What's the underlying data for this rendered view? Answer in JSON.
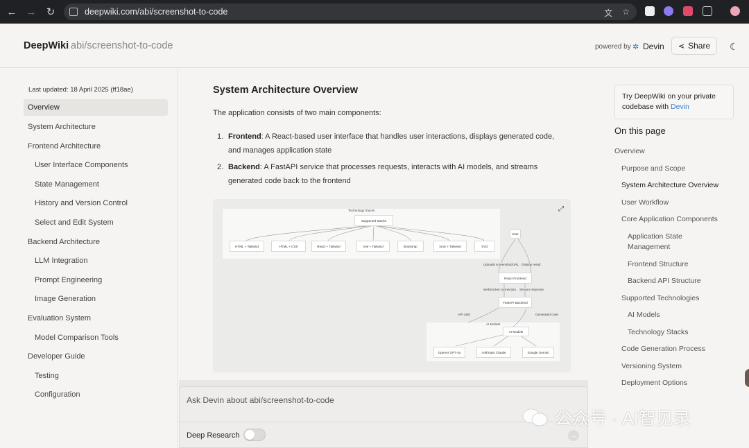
{
  "browser": {
    "url": "deepwiki.com/abi/screenshot-to-code"
  },
  "header": {
    "brand": "DeepWiki",
    "repo": "abi/screenshot-to-code",
    "powered_by": "powered by",
    "devin": "Devin",
    "share": "Share"
  },
  "left_nav": {
    "last_updated": "Last updated: 18 April 2025 (ff18ae)",
    "items": [
      {
        "label": "Overview",
        "level": 1,
        "active": true
      },
      {
        "label": "System Architecture",
        "level": 1
      },
      {
        "label": "Frontend Architecture",
        "level": 1
      },
      {
        "label": "User Interface Components",
        "level": 2
      },
      {
        "label": "State Management",
        "level": 2
      },
      {
        "label": "History and Version Control",
        "level": 2
      },
      {
        "label": "Select and Edit System",
        "level": 2
      },
      {
        "label": "Backend Architecture",
        "level": 1
      },
      {
        "label": "LLM Integration",
        "level": 2
      },
      {
        "label": "Prompt Engineering",
        "level": 2
      },
      {
        "label": "Image Generation",
        "level": 2
      },
      {
        "label": "Evaluation System",
        "level": 1
      },
      {
        "label": "Model Comparison Tools",
        "level": 2
      },
      {
        "label": "Developer Guide",
        "level": 1
      },
      {
        "label": "Testing",
        "level": 2
      },
      {
        "label": "Configuration",
        "level": 2
      }
    ]
  },
  "main": {
    "heading": "System Architecture Overview",
    "intro": "The application consists of two main components:",
    "list": [
      {
        "num": "1.",
        "term": "Frontend",
        "rest": ": A React-based user interface that handles user interactions, displays generated code, and manages application state"
      },
      {
        "num": "2.",
        "term": "Backend",
        "rest": ": A FastAPI service that processes requests, interacts with AI models, and streams generated code back to the frontend"
      }
    ]
  },
  "diagram": {
    "cluster_title": "Technology Stacks",
    "root": "Supported Stacks",
    "stacks": [
      "HTML + Tailwind",
      "HTML + CSS",
      "React + Tailwind",
      "Vue + Tailwind",
      "Bootstrap",
      "Ionic + Tailwind",
      "SVG"
    ],
    "user": "User",
    "edge_upload": "Uploads screenshot/URL",
    "edge_display": "Display result",
    "frontend": "React Frontend",
    "edge_ws": "WebSocket connection",
    "edge_stream": "Stream response",
    "backend": "FastAPI Backend",
    "edge_api": "API calls",
    "edge_generated": "Generated code",
    "models_cluster": "AI Models",
    "models_node": "AI Models",
    "models": [
      "OpenAI GPT-4o",
      "Anthropic Claude",
      "Google Gemini"
    ]
  },
  "right": {
    "promo_prefix": "Try DeepWiki on your private codebase with ",
    "promo_link": "Devin",
    "on_this_page": "On this page",
    "toc": [
      {
        "label": "Overview",
        "level": 1
      },
      {
        "label": "Purpose and Scope",
        "level": 2
      },
      {
        "label": "System Architecture Overview",
        "level": 2,
        "active": true
      },
      {
        "label": "User Workflow",
        "level": 2
      },
      {
        "label": "Core Application Components",
        "level": 2
      },
      {
        "label": "Application State",
        "level": 3
      },
      {
        "label": "Management",
        "level": 3
      },
      {
        "label": "Frontend Structure",
        "level": 3
      },
      {
        "label": "Backend API Structure",
        "level": 3
      },
      {
        "label": "Supported Technologies",
        "level": 2
      },
      {
        "label": "AI Models",
        "level": 3
      },
      {
        "label": "Technology Stacks",
        "level": 3
      },
      {
        "label": "Code Generation Process",
        "level": 2
      },
      {
        "label": "Versioning System",
        "level": 2
      },
      {
        "label": "Deployment Options",
        "level": 2
      }
    ]
  },
  "ask": {
    "placeholder": "Ask Devin about abi/screenshot-to-code",
    "deep_research": "Deep Research"
  },
  "watermark": "公众号 · AI智见录"
}
